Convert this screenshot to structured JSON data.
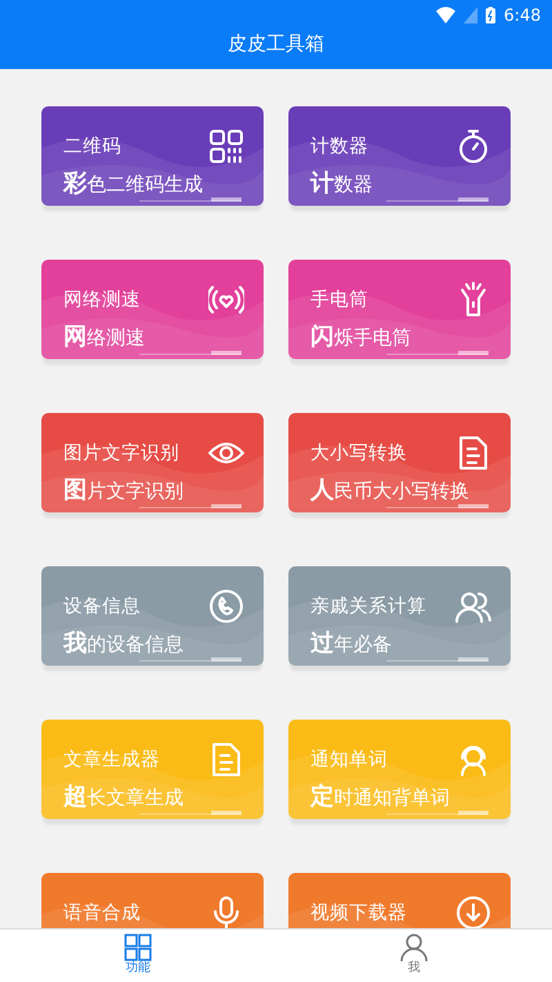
{
  "status_bar": {
    "time": "6:48"
  },
  "header": {
    "title": "皮皮工具箱"
  },
  "cards": [
    {
      "title": "二维码",
      "subtitle": "**彩**色二维码生成",
      "color": "#6a3db8"
    },
    {
      "title": "计数器",
      "subtitle": "**计**数器",
      "color": "#6a3db8"
    },
    {
      "title": "网络测速",
      "subtitle": "**网**络测速",
      "color": "#e2409a"
    },
    {
      "title": "手电筒",
      "subtitle": "**闪**烁手电筒",
      "color": "#e2409a"
    },
    {
      "title": "图片文字识别",
      "subtitle": "**图**片文字识别",
      "color": "#e64c45"
    },
    {
      "title": "大小写转换",
      "subtitle": "**人**民币大小写转换",
      "color": "#e64c45"
    },
    {
      "title": "设备信息",
      "subtitle": "**我**的设备信息",
      "color": "#8a9ba5"
    },
    {
      "title": "亲戚关系计算",
      "subtitle": "**过**年必备",
      "color": "#8a9ba5"
    },
    {
      "title": "文章生成器",
      "subtitle": "**超**长文章生成",
      "color": "#fbbb16"
    },
    {
      "title": "通知单词",
      "subtitle": "**定**时通知背单词",
      "color": "#fbbb16"
    },
    {
      "title": "语音合成",
      "color": "#f07a2c"
    },
    {
      "title": "视频下载器",
      "color": "#f07a2c"
    }
  ],
  "bottom_nav": [
    {
      "label": "功能",
      "selected": true
    },
    {
      "label": "我",
      "selected": false
    }
  ]
}
